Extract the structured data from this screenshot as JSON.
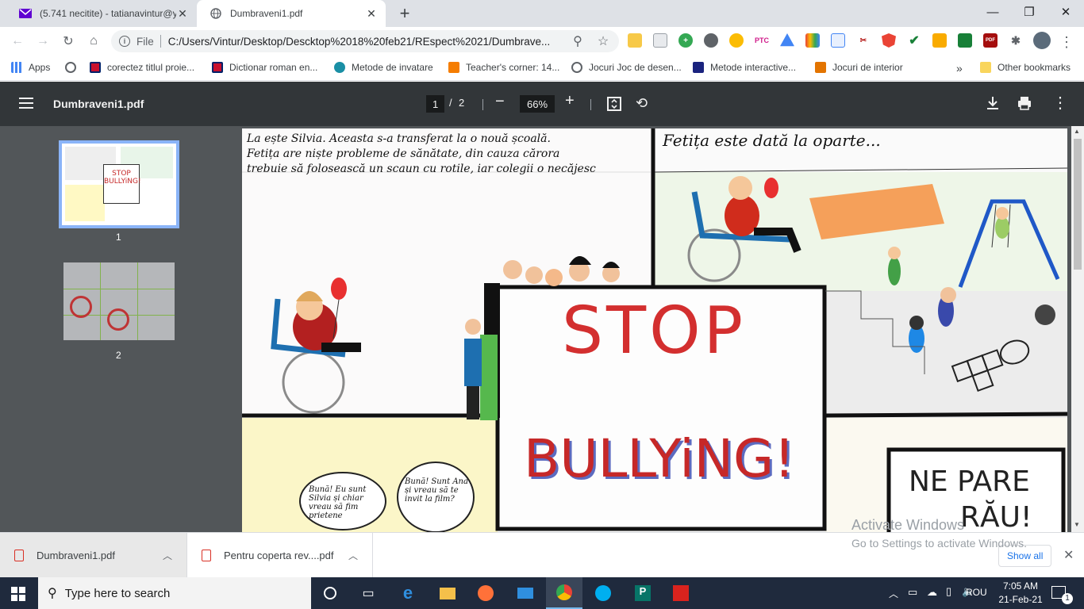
{
  "tabs": [
    {
      "title": "(5.741 necitite) - tatianavintur@y"
    },
    {
      "title": "Dumbraveni1.pdf"
    }
  ],
  "omnibox": {
    "scheme": "File",
    "url": "C:/Users/Vintur/Desktop/Descktop%2018%20feb21/REspect%2021/Dumbrave..."
  },
  "bookmarks": [
    {
      "label": "Apps"
    },
    {
      "label": "corectez titlul proie..."
    },
    {
      "label": "Dictionar roman en..."
    },
    {
      "label": "Metode de invatare"
    },
    {
      "label": "Teacher's corner: 14..."
    },
    {
      "label": "Jocuri Joc de desen..."
    },
    {
      "label": "Metode interactive..."
    },
    {
      "label": "Jocuri de interior"
    }
  ],
  "bookmarks_more": "»",
  "other_bookmarks": "Other bookmarks",
  "pdf": {
    "title": "Dumbraveni1.pdf",
    "page_current": "1",
    "page_sep": "/",
    "page_total": "2",
    "zoom": "66%",
    "thumbs": [
      {
        "label": "1"
      },
      {
        "label": "2"
      }
    ]
  },
  "comic": {
    "caption1_l1": "La ește Silvia. Aceasta s-a transferat la o nouă școală.",
    "caption1_l2": "Fetița are niște probleme de sănătate, din cauza cărora",
    "caption1_l3": "trebuie să folosească un scaun cu rotile, iar colegii o necăjesc",
    "caption2": "Fetița este dată la oparte...",
    "stop": "STOP",
    "bullying": "BULLYiNG!",
    "ne_pare": "NE PARE",
    "rau": "RĂU!",
    "bubble1": "Bună! Eu sunt Silvia și chiar vreau să fim prietene",
    "bubble2": "Bună! Sunt Ana și vreau să te invit la film?"
  },
  "watermark": {
    "l1": "Activate Windows",
    "l2": "Go to Settings to activate Windows."
  },
  "downloads": [
    {
      "name": "Dumbraveni1.pdf"
    },
    {
      "name": "Pentru coperta rev....pdf"
    }
  ],
  "show_all": "Show all",
  "taskbar": {
    "search_placeholder": "Type here to search",
    "lang": "ROU",
    "time": "7:05 AM",
    "date": "21-Feb-21",
    "notif": "1"
  },
  "colors": {
    "accent": "#1a73e8",
    "pdf_toolbar": "#323639",
    "viewer_bg": "#525659",
    "taskbar": "#1f2a3d"
  }
}
